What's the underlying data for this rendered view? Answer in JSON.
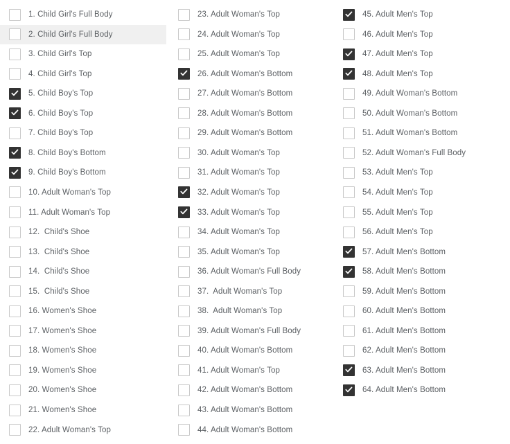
{
  "theme": {
    "background": "#ffffff",
    "text_color": "#5b5f63",
    "checkbox_border": "#c9c9c9",
    "checkbox_checked_fill": "#333333",
    "checkbox_check_color": "#ffffff",
    "row_highlight": "#f0f0f0"
  },
  "checkbox_list": {
    "total_items": 64,
    "checked_count": 14,
    "columns": [
      {
        "name": "column-1",
        "items": [
          {
            "index": 1,
            "label": "1. Child Girl's Full Body",
            "checked": false,
            "highlighted": false
          },
          {
            "index": 2,
            "label": "2. Child Girl's Full Body",
            "checked": false,
            "highlighted": true
          },
          {
            "index": 3,
            "label": "3. Child Girl's Top",
            "checked": false,
            "highlighted": false
          },
          {
            "index": 4,
            "label": "4. Child Girl's Top",
            "checked": false,
            "highlighted": false
          },
          {
            "index": 5,
            "label": "5. Child Boy's Top",
            "checked": true,
            "highlighted": false
          },
          {
            "index": 6,
            "label": "6. Child Boy's Top",
            "checked": true,
            "highlighted": false
          },
          {
            "index": 7,
            "label": "7. Child Boy's Top",
            "checked": false,
            "highlighted": false
          },
          {
            "index": 8,
            "label": "8. Child Boy's Bottom",
            "checked": true,
            "highlighted": false
          },
          {
            "index": 9,
            "label": "9. Child Boy's Bottom",
            "checked": true,
            "highlighted": false
          },
          {
            "index": 10,
            "label": "10. Adult Woman's Top",
            "checked": false,
            "highlighted": false
          },
          {
            "index": 11,
            "label": "11. Adult Woman's Top",
            "checked": false,
            "highlighted": false
          },
          {
            "index": 12,
            "label": "12.  Child's Shoe",
            "checked": false,
            "highlighted": false
          },
          {
            "index": 13,
            "label": "13.  Child's Shoe",
            "checked": false,
            "highlighted": false
          },
          {
            "index": 14,
            "label": "14.  Child's Shoe",
            "checked": false,
            "highlighted": false
          },
          {
            "index": 15,
            "label": "15.  Child's Shoe",
            "checked": false,
            "highlighted": false
          },
          {
            "index": 16,
            "label": "16. Women's Shoe",
            "checked": false,
            "highlighted": false
          },
          {
            "index": 17,
            "label": "17. Women's Shoe",
            "checked": false,
            "highlighted": false
          },
          {
            "index": 18,
            "label": "18. Women's Shoe",
            "checked": false,
            "highlighted": false
          },
          {
            "index": 19,
            "label": "19. Women's Shoe",
            "checked": false,
            "highlighted": false
          },
          {
            "index": 20,
            "label": "20. Women's Shoe",
            "checked": false,
            "highlighted": false
          },
          {
            "index": 21,
            "label": "21. Women's Shoe",
            "checked": false,
            "highlighted": false
          },
          {
            "index": 22,
            "label": "22. Adult Woman's Top",
            "checked": false,
            "highlighted": false
          }
        ]
      },
      {
        "name": "column-2",
        "items": [
          {
            "index": 23,
            "label": "23. Adult Woman's Top",
            "checked": false,
            "highlighted": false
          },
          {
            "index": 24,
            "label": "24. Adult Woman's Top",
            "checked": false,
            "highlighted": false
          },
          {
            "index": 25,
            "label": "25. Adult Woman's Top",
            "checked": false,
            "highlighted": false
          },
          {
            "index": 26,
            "label": "26. Adult Woman's Bottom",
            "checked": true,
            "highlighted": false
          },
          {
            "index": 27,
            "label": "27. Adult Woman's Bottom",
            "checked": false,
            "highlighted": false
          },
          {
            "index": 28,
            "label": "28. Adult Woman's Bottom",
            "checked": false,
            "highlighted": false
          },
          {
            "index": 29,
            "label": "29. Adult Woman's Bottom",
            "checked": false,
            "highlighted": false
          },
          {
            "index": 30,
            "label": "30. Adult Woman's Top",
            "checked": false,
            "highlighted": false
          },
          {
            "index": 31,
            "label": "31. Adult Woman's Top",
            "checked": false,
            "highlighted": false
          },
          {
            "index": 32,
            "label": "32. Adult Woman's Top",
            "checked": true,
            "highlighted": false
          },
          {
            "index": 33,
            "label": "33. Adult Woman's Top",
            "checked": true,
            "highlighted": false
          },
          {
            "index": 34,
            "label": "34. Adult Woman's Top",
            "checked": false,
            "highlighted": false
          },
          {
            "index": 35,
            "label": "35. Adult Woman's Top",
            "checked": false,
            "highlighted": false
          },
          {
            "index": 36,
            "label": "36. Adult Woman's Full Body",
            "checked": false,
            "highlighted": false
          },
          {
            "index": 37,
            "label": "37.  Adult Woman's Top",
            "checked": false,
            "highlighted": false
          },
          {
            "index": 38,
            "label": "38.  Adult Woman's Top",
            "checked": false,
            "highlighted": false
          },
          {
            "index": 39,
            "label": "39. Adult Woman's Full Body",
            "checked": false,
            "highlighted": false
          },
          {
            "index": 40,
            "label": "40. Adult Woman's Bottom",
            "checked": false,
            "highlighted": false
          },
          {
            "index": 41,
            "label": "41. Adult Woman's Top",
            "checked": false,
            "highlighted": false
          },
          {
            "index": 42,
            "label": "42. Adult Woman's Bottom",
            "checked": false,
            "highlighted": false
          },
          {
            "index": 43,
            "label": "43. Adult Woman's Bottom",
            "checked": false,
            "highlighted": false
          },
          {
            "index": 44,
            "label": "44. Adult Woman's Bottom",
            "checked": false,
            "highlighted": false
          }
        ]
      },
      {
        "name": "column-3",
        "items": [
          {
            "index": 45,
            "label": "45. Adult Men's Top",
            "checked": true,
            "highlighted": false
          },
          {
            "index": 46,
            "label": "46. Adult Men's Top",
            "checked": false,
            "highlighted": false
          },
          {
            "index": 47,
            "label": "47. Adult Men's Top",
            "checked": true,
            "highlighted": false
          },
          {
            "index": 48,
            "label": "48. Adult Men's Top",
            "checked": true,
            "highlighted": false
          },
          {
            "index": 49,
            "label": "49. Adult Woman's Bottom",
            "checked": false,
            "highlighted": false
          },
          {
            "index": 50,
            "label": "50. Adult Woman's Bottom",
            "checked": false,
            "highlighted": false
          },
          {
            "index": 51,
            "label": "51. Adult Woman's Bottom",
            "checked": false,
            "highlighted": false
          },
          {
            "index": 52,
            "label": "52. Adult Woman's Full Body",
            "checked": false,
            "highlighted": false
          },
          {
            "index": 53,
            "label": "53. Adult Men's Top",
            "checked": false,
            "highlighted": false
          },
          {
            "index": 54,
            "label": "54. Adult Men's Top",
            "checked": false,
            "highlighted": false
          },
          {
            "index": 55,
            "label": "55. Adult Men's Top",
            "checked": false,
            "highlighted": false
          },
          {
            "index": 56,
            "label": "56. Adult Men's Top",
            "checked": false,
            "highlighted": false
          },
          {
            "index": 57,
            "label": "57. Adult Men's Bottom",
            "checked": true,
            "highlighted": false
          },
          {
            "index": 58,
            "label": "58. Adult Men's Bottom",
            "checked": true,
            "highlighted": false
          },
          {
            "index": 59,
            "label": "59. Adult Men's Bottom",
            "checked": false,
            "highlighted": false
          },
          {
            "index": 60,
            "label": "60. Adult Men's Bottom",
            "checked": false,
            "highlighted": false
          },
          {
            "index": 61,
            "label": "61. Adult Men's Bottom",
            "checked": false,
            "highlighted": false
          },
          {
            "index": 62,
            "label": "62. Adult Men's Bottom",
            "checked": false,
            "highlighted": false
          },
          {
            "index": 63,
            "label": "63. Adult Men's Bottom",
            "checked": true,
            "highlighted": false
          },
          {
            "index": 64,
            "label": "64. Adult Men's Bottom",
            "checked": true,
            "highlighted": false
          }
        ]
      }
    ]
  }
}
